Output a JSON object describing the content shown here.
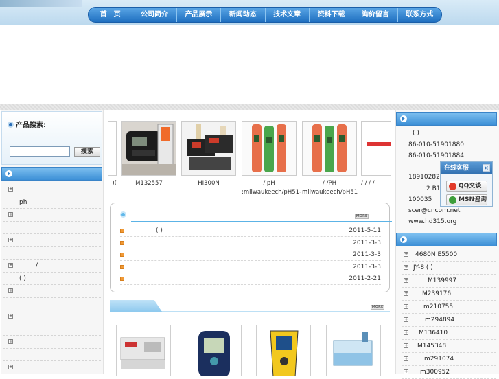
{
  "nav": {
    "items": [
      "首　页",
      "公司简介",
      "产品展示",
      "新闻动态",
      "技术文章",
      "资料下载",
      "询价留言",
      "联系方式"
    ]
  },
  "search": {
    "title": "产品搜索:",
    "input_value": "",
    "button": "搜索"
  },
  "categories": [
    {
      "label": "",
      "toggle": "+"
    },
    {
      "label": "ph",
      "toggle": ""
    },
    {
      "label": "",
      "toggle": "+"
    },
    {
      "label": "",
      "toggle": ""
    },
    {
      "label": "",
      "toggle": "+"
    },
    {
      "label": "",
      "toggle": ""
    },
    {
      "label": "/",
      "toggle": "+"
    },
    {
      "label": "( )",
      "toggle": ""
    },
    {
      "label": "",
      "toggle": "+"
    },
    {
      "label": "",
      "toggle": ""
    },
    {
      "label": "",
      "toggle": "+"
    },
    {
      "label": "",
      "toggle": ""
    },
    {
      "label": "",
      "toggle": "+"
    },
    {
      "label": "",
      "toggle": ""
    },
    {
      "label": "",
      "toggle": "+"
    }
  ],
  "marquee": [
    {
      "caption": ")(",
      "img": "partial"
    },
    {
      "caption": "M132557",
      "img": "meter-black"
    },
    {
      "caption": "HI300N",
      "img": "bench-meters"
    },
    {
      "caption": "/ pH\n:milwaukeech/pH51-",
      "img": "pen-meter"
    },
    {
      "caption": "/ /PH\nmilwaukeech/pH51",
      "img": "pen-meter"
    },
    {
      "caption": "/ / / /",
      "img": "partial"
    }
  ],
  "news": {
    "more": "MORE",
    "items": [
      {
        "title": "( )",
        "date": "2011-5-11"
      },
      {
        "title": "",
        "date": "2011-3-3"
      },
      {
        "title": "",
        "date": "2011-3-3"
      },
      {
        "title": "",
        "date": "2011-3-3"
      },
      {
        "title": "",
        "date": "2011-2-21"
      }
    ]
  },
  "products": {
    "more": "MORE"
  },
  "contact": {
    "lines": [
      "( )",
      "86-010-51901880",
      "86-010-51901884",
      "",
      "18910282277",
      "2 B1",
      "100035",
      "scer@cncom.net",
      "www.hd315.org"
    ]
  },
  "float_panel": {
    "title": "在线客服",
    "close": "×",
    "qq": "QQ交谈",
    "msn": "MSN咨询"
  },
  "product_list": [
    {
      "label": "4680N E5500",
      "indent": 20
    },
    {
      "label": "JY-8 ( )",
      "indent": 17
    },
    {
      "label": "M139997",
      "indent": 38
    },
    {
      "label": "M239176",
      "indent": 30
    },
    {
      "label": "m210755",
      "indent": 32
    },
    {
      "label": "m294894",
      "indent": 34
    },
    {
      "label": "M136410",
      "indent": 25
    },
    {
      "label": "M145348",
      "indent": 23
    },
    {
      "label": "m291074",
      "indent": 33
    },
    {
      "label": "m300952",
      "indent": 27
    }
  ],
  "colors": {
    "nav_blue": "#1f6fc0",
    "accent_light": "#7ec0f0",
    "bullet_orange": "#f19a36",
    "qq_red": "#e23b2a",
    "msn_green": "#3d9e3a"
  }
}
